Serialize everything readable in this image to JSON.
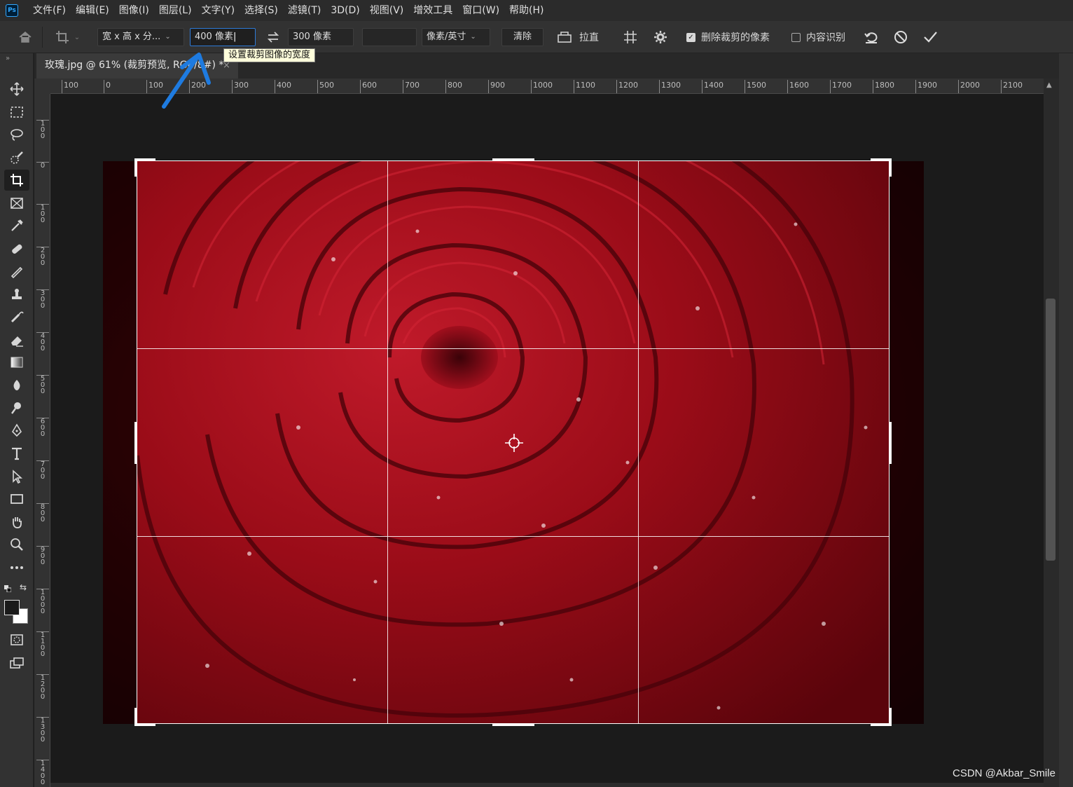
{
  "menu": [
    "文件(F)",
    "编辑(E)",
    "图像(I)",
    "图层(L)",
    "文字(Y)",
    "选择(S)",
    "滤镜(T)",
    "3D(D)",
    "视图(V)",
    "增效工具",
    "窗口(W)",
    "帮助(H)"
  ],
  "app_logo": "Ps",
  "options": {
    "ratio_preset": "宽 x 高 x 分...",
    "width_value": "400 像素",
    "height_value": "300 像素",
    "resolution_value": "",
    "resolution_unit": "像素/英寸",
    "clear_label": "清除",
    "straighten_label": "拉直",
    "delete_cropped_label": "删除裁剪的像素",
    "delete_cropped_checked": true,
    "content_aware_label": "内容识别",
    "content_aware_checked": false
  },
  "tooltip": "设置裁剪图像的宽度",
  "document": {
    "tab_title": "玫瑰.jpg @ 61% (裁剪预览, RGB/8#) *",
    "close_glyph": "×"
  },
  "ruler_h": [
    "100",
    "0",
    "100",
    "200",
    "300",
    "400",
    "500",
    "600",
    "700",
    "800",
    "900",
    "1000",
    "1100",
    "1200",
    "1300",
    "1400",
    "1500",
    "1600",
    "1700",
    "1800",
    "1900",
    "2000",
    "2100"
  ],
  "ruler_v": [
    "100",
    "0",
    "100",
    "200",
    "300",
    "400",
    "500",
    "600",
    "700",
    "800",
    "900",
    "1000",
    "1100",
    "1200",
    "1300",
    "1400"
  ],
  "watermark": "CSDN @Akbar_Smile",
  "colors": {
    "accent": "#2d7ad8",
    "rose": "#8b0a14",
    "arrow": "#1e7be0"
  }
}
